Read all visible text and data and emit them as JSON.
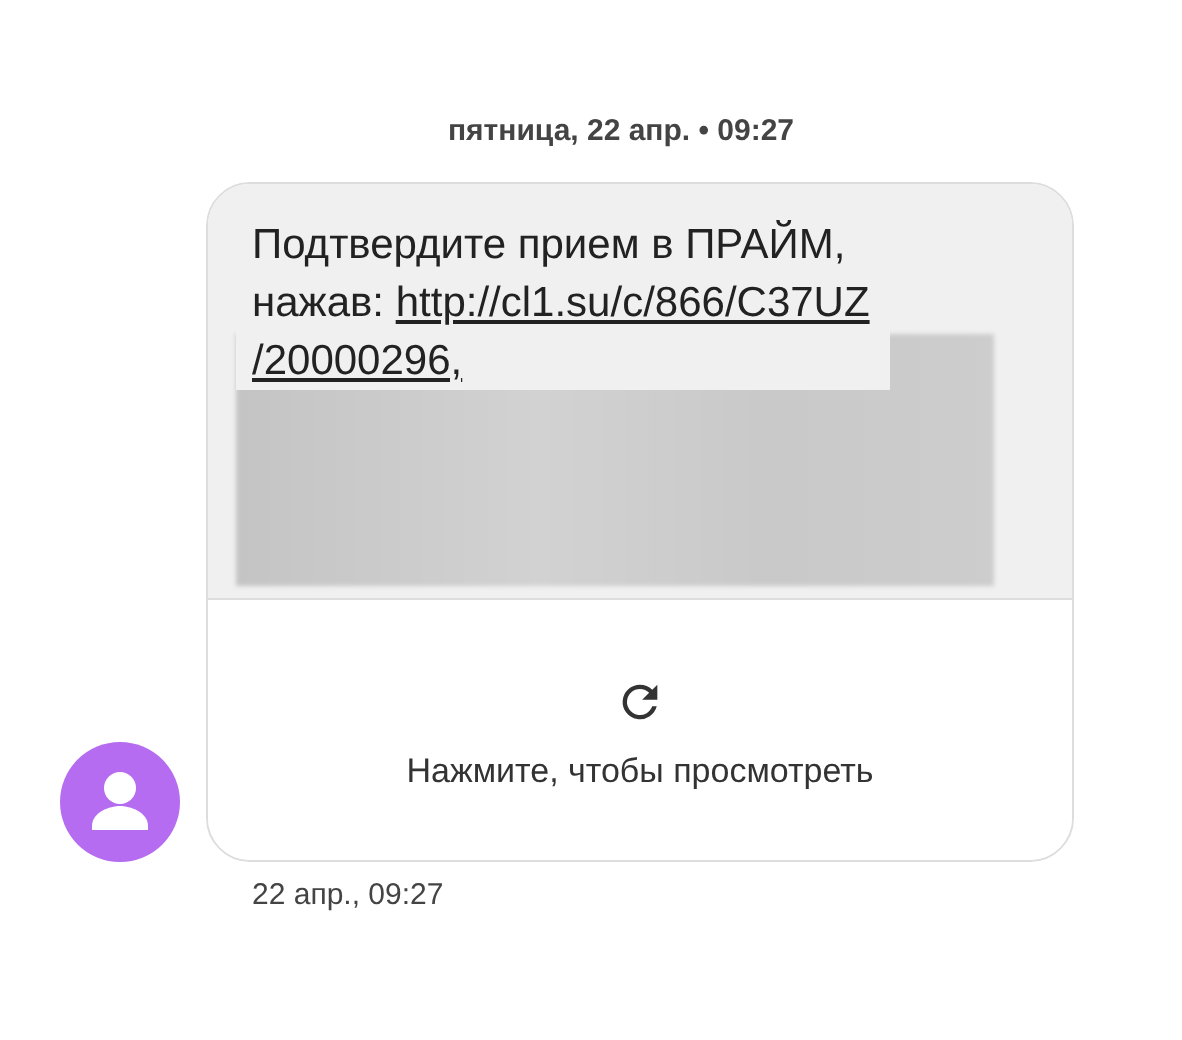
{
  "date_header": "пятница, 22 апр. • 09:27",
  "message": {
    "text_lines": [
      "Подтвердите прием в ПРАЙМ,",
      "нажав:"
    ],
    "link_lines": [
      "http://cl1.su/c/866/C37UZ",
      "/20000296,"
    ],
    "redacted": true
  },
  "preview": {
    "label": "Нажмите, чтобы просмотреть"
  },
  "timestamp": "22 апр., 09:27"
}
